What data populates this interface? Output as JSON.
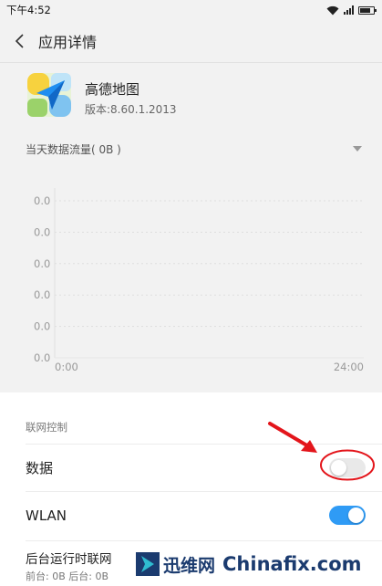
{
  "status_bar": {
    "time": "下午4:52",
    "icons": [
      "wifi-icon",
      "signal-icon",
      "battery-icon"
    ]
  },
  "title_bar": {
    "back_icon": "chevron-left-icon",
    "title": "应用详情"
  },
  "app": {
    "name": "高德地图",
    "version": "版本:8.60.1.2013",
    "icon": "amap-app-icon"
  },
  "traffic": {
    "selector_label": "当天数据流量( 0B )",
    "dropdown_icon": "dropdown-triangle-icon"
  },
  "chart_data": {
    "type": "line",
    "x_tick_labels": [
      "0:00",
      "24:00"
    ],
    "y_tick_labels": [
      "0.0",
      "0.0",
      "0.0",
      "0.0",
      "0.0",
      "0.0"
    ],
    "series": [
      {
        "values": [
          0,
          0
        ]
      }
    ],
    "grid": true
  },
  "network_control": {
    "section_title": "联网控制",
    "data_label": "数据",
    "data_enabled": false,
    "wlan_label": "WLAN",
    "wlan_enabled": true,
    "background_title": "后台运行时联网",
    "background_sub": "前台: 0B  后台: 0B"
  },
  "watermark": {
    "brand_cn": "迅维网",
    "brand_en": "Chinafix.com"
  },
  "colors": {
    "accent": "#2f9bf5",
    "annotation": "#e3151b"
  }
}
